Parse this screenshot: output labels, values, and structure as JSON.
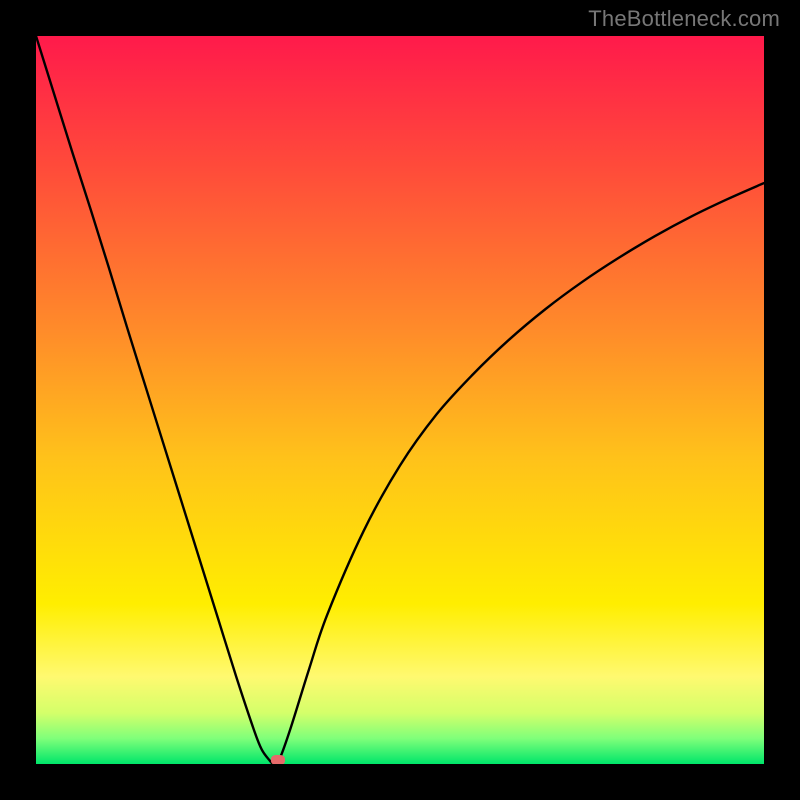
{
  "watermark": {
    "text": "TheBottleneck.com"
  },
  "chart_data": {
    "type": "line",
    "title": "",
    "xlabel": "",
    "ylabel": "",
    "xlim": [
      0,
      100
    ],
    "ylim": [
      0,
      100
    ],
    "grid": false,
    "legend": false,
    "background_gradient": {
      "direction": "vertical",
      "stops": [
        {
          "pos": 0.0,
          "color": "#ff1a4b"
        },
        {
          "pos": 0.18,
          "color": "#ff4b3a"
        },
        {
          "pos": 0.4,
          "color": "#ff8a2a"
        },
        {
          "pos": 0.58,
          "color": "#ffc21a"
        },
        {
          "pos": 0.78,
          "color": "#ffee00"
        },
        {
          "pos": 0.88,
          "color": "#fff970"
        },
        {
          "pos": 0.93,
          "color": "#d4ff6a"
        },
        {
          "pos": 0.965,
          "color": "#7fff7a"
        },
        {
          "pos": 1.0,
          "color": "#00e66a"
        }
      ]
    },
    "series": [
      {
        "name": "bottleneck-curve",
        "color": "#000000",
        "stroke_width": 2.4,
        "x": [
          0.0,
          2.5,
          5.0,
          7.5,
          10.0,
          12.5,
          15.0,
          17.5,
          20.0,
          22.5,
          25.0,
          27.5,
          30.0,
          31.0,
          32.0,
          32.7,
          33.5,
          35.0,
          37.5,
          40.0,
          45.0,
          50.0,
          55.0,
          60.0,
          65.0,
          70.0,
          75.0,
          80.0,
          85.0,
          90.0,
          95.0,
          100.0
        ],
        "y": [
          100.0,
          92.0,
          84.0,
          76.2,
          68.2,
          60.0,
          52.0,
          44.0,
          36.0,
          28.0,
          20.0,
          12.0,
          4.5,
          2.0,
          0.6,
          0.0,
          0.8,
          5.0,
          13.0,
          20.5,
          32.0,
          41.0,
          48.0,
          53.5,
          58.3,
          62.5,
          66.2,
          69.5,
          72.5,
          75.2,
          77.6,
          79.8
        ]
      }
    ],
    "marker": {
      "name": "optimal-point",
      "x": 33.3,
      "y": 0.5,
      "color": "#e66a6a"
    }
  }
}
